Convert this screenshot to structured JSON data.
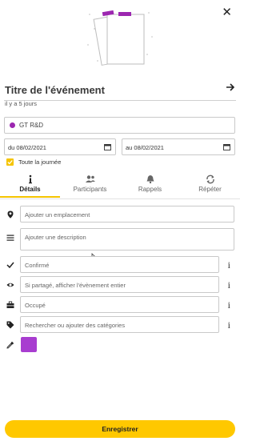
{
  "header": {
    "title_value": "Titre de l'événement",
    "relative_time": "il y a 5 jours",
    "close_icon": "close-icon",
    "submit_icon": "arrow-right-icon"
  },
  "calendar": {
    "name": "GT R&D",
    "color": "#9c27b0"
  },
  "dates": {
    "start": "du 08/02/2021",
    "end": "au 08/02/2021"
  },
  "all_day": {
    "label": "Toute la journée",
    "checked": true
  },
  "tabs": [
    {
      "label": "Détails",
      "icon": "info-icon",
      "active": true
    },
    {
      "label": "Participants",
      "icon": "people-icon",
      "active": false
    },
    {
      "label": "Rappels",
      "icon": "bell-icon",
      "active": false
    },
    {
      "label": "Répéter",
      "icon": "repeat-icon",
      "active": false
    }
  ],
  "form": {
    "location_placeholder": "Ajouter un emplacement",
    "description_placeholder": "Ajouter une description",
    "status_value": "Confirmé",
    "visibility_value": "Si partagé, afficher l'évènement entier",
    "availability_value": "Occupé",
    "categories_placeholder": "Rechercher ou ajouter des catégories",
    "color_value": "#a83dd0"
  },
  "footer": {
    "save_label": "Enregistrer"
  },
  "theme": {
    "accent": "#ffc800"
  }
}
